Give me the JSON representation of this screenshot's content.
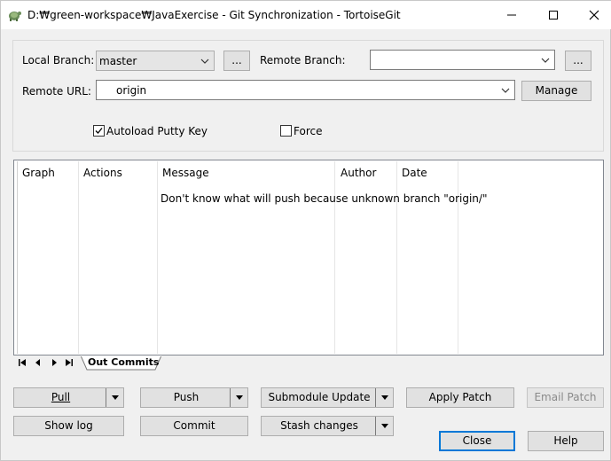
{
  "window": {
    "title": "D:₩green-workspace₩JavaExercise - Git Synchronization - TortoiseGit"
  },
  "form": {
    "local_branch_label": "Local Branch:",
    "local_branch_value": "master",
    "local_browse_label": "...",
    "remote_branch_label": "Remote Branch:",
    "remote_branch_value": "",
    "remote_browse_label": "...",
    "remote_url_label": "Remote URL:",
    "remote_url_value": "origin",
    "manage_label": "Manage",
    "autoload_label": "Autoload Putty Key",
    "autoload_checked": true,
    "force_label": "Force",
    "force_checked": false
  },
  "list": {
    "columns": [
      "Graph",
      "Actions",
      "Message",
      "Author",
      "Date"
    ],
    "message": "Don't know what will push because unknown branch \"origin/\""
  },
  "tabs": {
    "active": "Out Commits"
  },
  "buttons": {
    "pull": "Pull",
    "push": "Push",
    "submodule_update": "Submodule Update",
    "apply_patch": "Apply Patch",
    "email_patch": "Email Patch",
    "show_log": "Show log",
    "commit": "Commit",
    "stash_changes": "Stash changes",
    "close": "Close",
    "help": "Help"
  },
  "icons": {
    "app": "tortoisegit-icon",
    "minimize": "minimize-icon",
    "maximize": "maximize-icon",
    "close": "close-icon"
  },
  "colors": {
    "accent": "#0078d7",
    "window_bg": "#f0f0f0",
    "list_bg": "#ffffff"
  }
}
